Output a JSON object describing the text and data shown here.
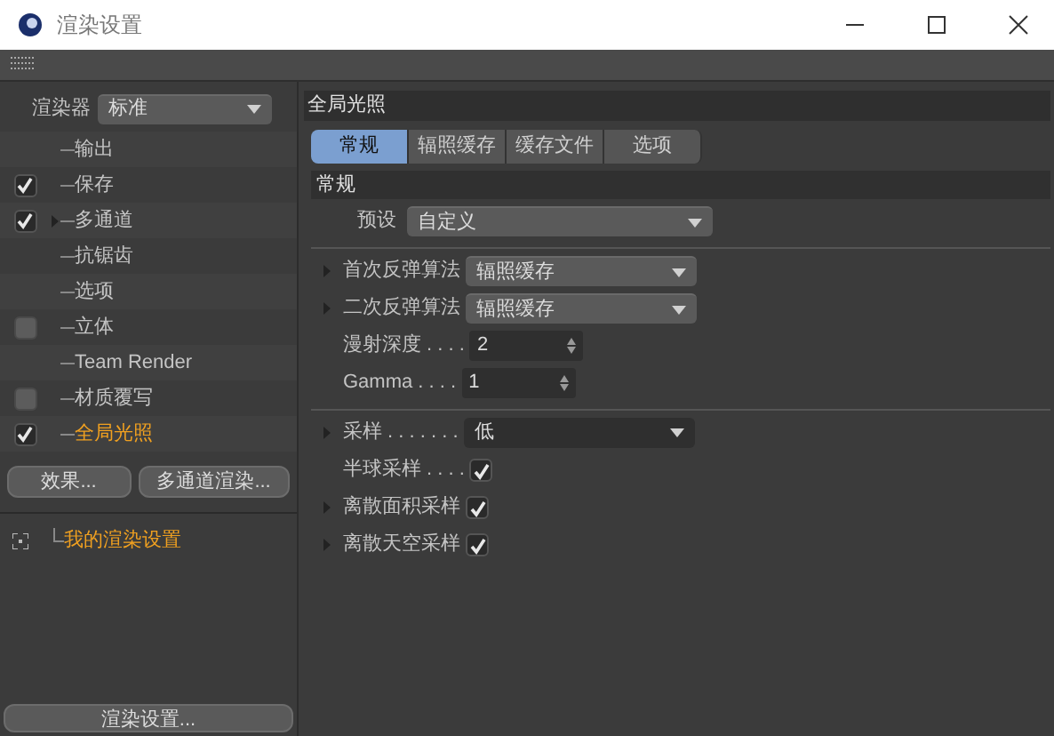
{
  "window": {
    "title": "渲染设置"
  },
  "renderer": {
    "label": "渲染器",
    "value": "标准"
  },
  "tree": [
    {
      "label": "输出",
      "kind": "plain",
      "selected": false,
      "expandable": false
    },
    {
      "label": "保存",
      "kind": "checkbox",
      "checked": true,
      "selected": false,
      "expandable": false
    },
    {
      "label": "多通道",
      "kind": "checkbox",
      "checked": true,
      "selected": false,
      "expandable": true
    },
    {
      "label": "抗锯齿",
      "kind": "plain",
      "selected": false,
      "expandable": false
    },
    {
      "label": "选项",
      "kind": "plain",
      "selected": false,
      "expandable": false
    },
    {
      "label": "立体",
      "kind": "checkbox",
      "checked": false,
      "selected": false,
      "expandable": false
    },
    {
      "label": "Team Render",
      "kind": "plain",
      "selected": false,
      "expandable": false
    },
    {
      "label": "材质覆写",
      "kind": "checkbox",
      "checked": false,
      "selected": false,
      "expandable": false
    },
    {
      "label": "全局光照",
      "kind": "checkbox",
      "checked": true,
      "selected": true,
      "expandable": false
    }
  ],
  "left_buttons": [
    "效果...",
    "多通道渲染..."
  ],
  "settings_list": [
    {
      "label": "我的渲染设置",
      "selected": true
    }
  ],
  "bottom_button": "渲染设置...",
  "panel": {
    "title": "全局光照",
    "tabs": [
      {
        "label": "常规",
        "selected": true
      },
      {
        "label": "辐照缓存",
        "selected": false
      },
      {
        "label": "缓存文件",
        "selected": false
      },
      {
        "label": "选项",
        "selected": false
      }
    ],
    "section": "常规",
    "preset": {
      "label": "预设",
      "value": "自定义"
    },
    "groups": [
      [
        {
          "kind": "dropdown",
          "label": "首次反弹算法",
          "value": "辐照缓存",
          "expandable": true
        },
        {
          "kind": "dropdown",
          "label": "二次反弹算法",
          "value": "辐照缓存",
          "expandable": true
        },
        {
          "kind": "spin",
          "label": "漫射深度",
          "dots": ". . . .",
          "value": "2",
          "expandable": false
        },
        {
          "kind": "spin",
          "label": "Gamma",
          "dots": ". . . .",
          "value": "1",
          "expandable": false
        }
      ],
      [
        {
          "kind": "dropdown",
          "label": "采样",
          "dots": ". . . . . . .",
          "value": "低",
          "expandable": true
        },
        {
          "kind": "checkbox",
          "label": "半球采样",
          "dots": ". . . .",
          "checked": true,
          "expandable": false
        },
        {
          "kind": "checkbox",
          "label": "离散面积采样",
          "checked": true,
          "expandable": true
        },
        {
          "kind": "checkbox",
          "label": "离散天空采样",
          "checked": true,
          "expandable": true
        }
      ]
    ]
  }
}
